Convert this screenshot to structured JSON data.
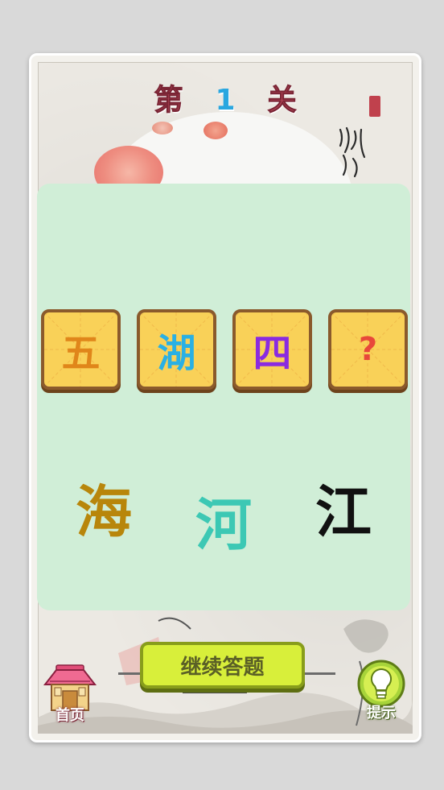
{
  "header": {
    "title_prefix": "第",
    "level_number": "1",
    "title_suffix": "关"
  },
  "tiles": [
    {
      "char": "五",
      "color": "#e0861a"
    },
    {
      "char": "湖",
      "color": "#2ab0e4"
    },
    {
      "char": "四",
      "color": "#8a2be0"
    },
    {
      "char": "?",
      "color": "#e8473a"
    }
  ],
  "choices": [
    {
      "char": "海",
      "color": "#b8860b"
    },
    {
      "char": "河",
      "color": "#3cc8b4"
    },
    {
      "char": "江",
      "color": "#111111"
    }
  ],
  "buttons": {
    "continue_label": "继续答题",
    "home_label": "首页",
    "hint_label": "提示"
  },
  "colors": {
    "play_area": "#d0eed7",
    "tile_fill": "#f9d158",
    "continue_fill": "#d8ef3a"
  }
}
